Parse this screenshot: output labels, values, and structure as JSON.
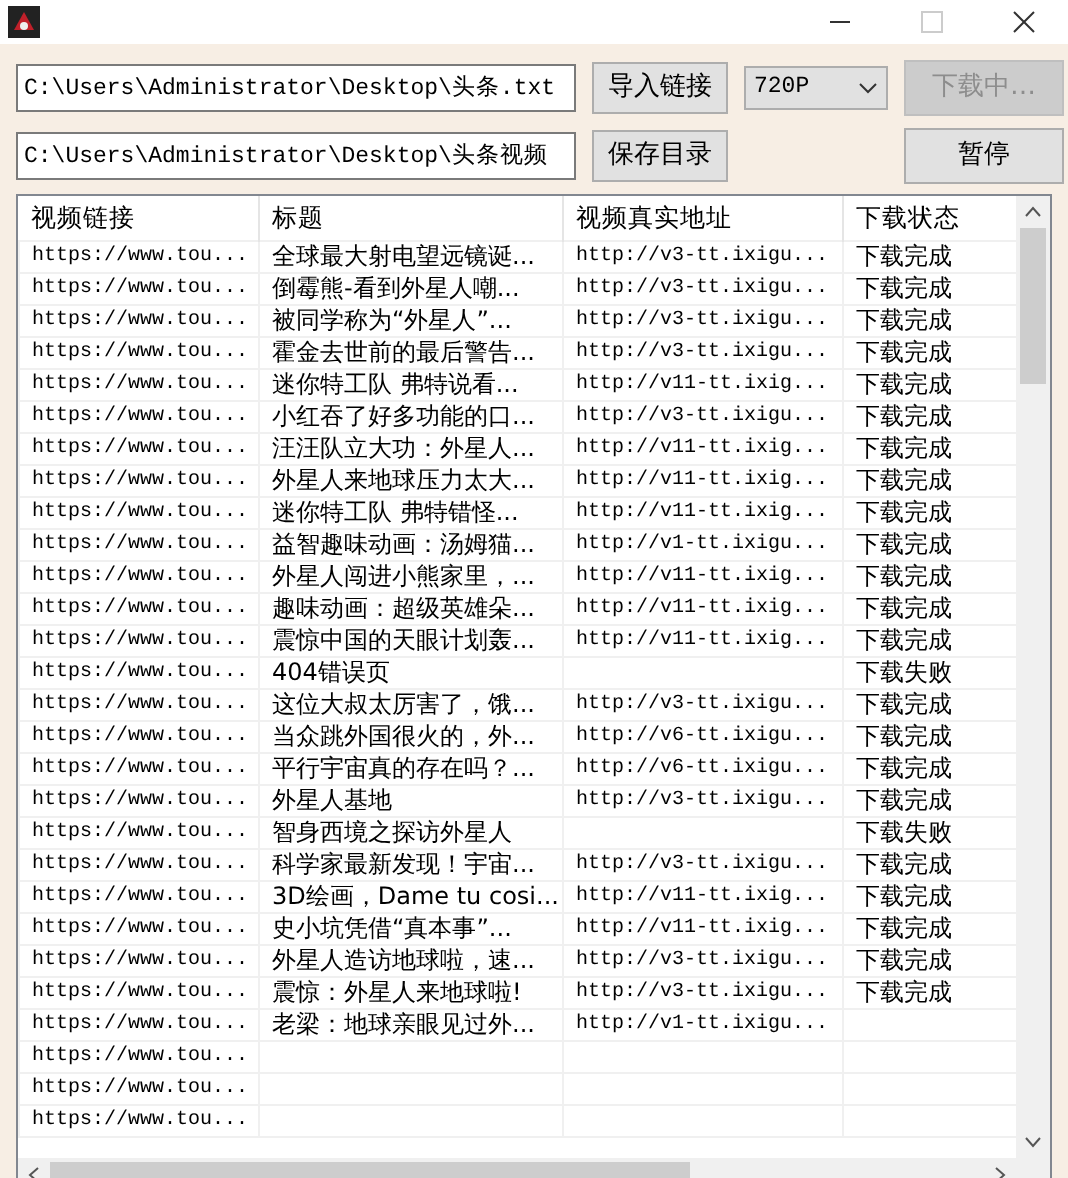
{
  "file_field": {
    "value": "C:\\Users\\Administrator\\Desktop\\头条.txt"
  },
  "import_button": {
    "label": "导入链接"
  },
  "quality_select": {
    "value": "720P"
  },
  "download_button": {
    "label": "下载中…",
    "disabled": true
  },
  "folder_field": {
    "value": "C:\\Users\\Administrator\\Desktop\\头条视频"
  },
  "save_dir_button": {
    "label": "保存目录"
  },
  "pause_button": {
    "label": "暂停",
    "disabled": false
  },
  "table": {
    "columns": [
      "视频链接",
      "标题",
      "视频真实地址",
      "下载状态"
    ],
    "rows": [
      [
        "https://www.tou...",
        "全球最大射电望远镜诞...",
        "http://v3-tt.ixigu...",
        "下载完成"
      ],
      [
        "https://www.tou...",
        "倒霉熊-看到外星人嘲...",
        "http://v3-tt.ixigu...",
        "下载完成"
      ],
      [
        "https://www.tou...",
        "被同学称为“外星人”...",
        "http://v3-tt.ixigu...",
        "下载完成"
      ],
      [
        "https://www.tou...",
        "霍金去世前的最后警告...",
        "http://v3-tt.ixigu...",
        "下载完成"
      ],
      [
        "https://www.tou...",
        "迷你特工队 弗特说看...",
        "http://v11-tt.ixig...",
        "下载完成"
      ],
      [
        "https://www.tou...",
        "小红吞了好多功能的口...",
        "http://v3-tt.ixigu...",
        "下载完成"
      ],
      [
        "https://www.tou...",
        "汪汪队立大功：外星人...",
        "http://v11-tt.ixig...",
        "下载完成"
      ],
      [
        "https://www.tou...",
        "外星人来地球压力太大...",
        "http://v11-tt.ixig...",
        "下载完成"
      ],
      [
        "https://www.tou...",
        "迷你特工队 弗特错怪...",
        "http://v11-tt.ixig...",
        "下载完成"
      ],
      [
        "https://www.tou...",
        "益智趣味动画：汤姆猫...",
        "http://v1-tt.ixigu...",
        "下载完成"
      ],
      [
        "https://www.tou...",
        "外星人闯进小熊家里，...",
        "http://v11-tt.ixig...",
        "下载完成"
      ],
      [
        "https://www.tou...",
        "趣味动画：超级英雄朵...",
        "http://v11-tt.ixig...",
        "下载完成"
      ],
      [
        "https://www.tou...",
        "震惊中国的天眼计划轰...",
        "http://v11-tt.ixig...",
        "下载完成"
      ],
      [
        "https://www.tou...",
        "404错误页",
        "",
        "下载失败"
      ],
      [
        "https://www.tou...",
        "这位大叔太厉害了，饿...",
        "http://v3-tt.ixigu...",
        "下载完成"
      ],
      [
        "https://www.tou...",
        "当众跳外国很火的，外...",
        "http://v6-tt.ixigu...",
        "下载完成"
      ],
      [
        "https://www.tou...",
        "平行宇宙真的存在吗？...",
        "http://v6-tt.ixigu...",
        "下载完成"
      ],
      [
        "https://www.tou...",
        "外星人基地",
        "http://v3-tt.ixigu...",
        "下载完成"
      ],
      [
        "https://www.tou...",
        "智身西境之探访外星人",
        "",
        "下载失败"
      ],
      [
        "https://www.tou...",
        "科学家最新发现！宇宙...",
        "http://v3-tt.ixigu...",
        "下载完成"
      ],
      [
        "https://www.tou...",
        "3D绘画，Dame tu cosi...",
        "http://v11-tt.ixig...",
        "下载完成"
      ],
      [
        "https://www.tou...",
        "史小坑凭借“真本事”...",
        "http://v11-tt.ixig...",
        "下载完成"
      ],
      [
        "https://www.tou...",
        "外星人造访地球啦，速...",
        "http://v3-tt.ixigu...",
        "下载完成"
      ],
      [
        "https://www.tou...",
        "震惊：外星人来地球啦!",
        "http://v3-tt.ixigu...",
        "下载完成"
      ],
      [
        "https://www.tou...",
        "老梁：地球亲眼见过外...",
        "http://v1-tt.ixigu...",
        ""
      ],
      [
        "https://www.tou...",
        "",
        "",
        ""
      ],
      [
        "https://www.tou...",
        "",
        "",
        ""
      ],
      [
        "https://www.tou...",
        "",
        "",
        ""
      ]
    ]
  }
}
